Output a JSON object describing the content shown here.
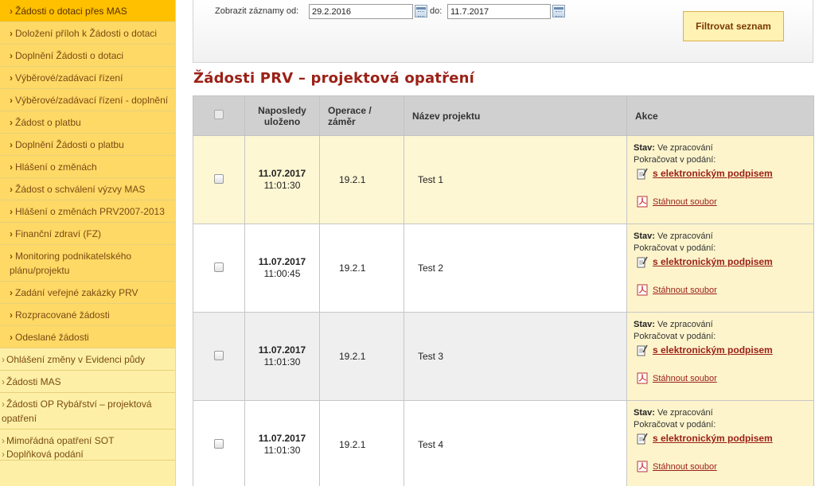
{
  "sidebar": {
    "items": [
      {
        "label": "Žádosti o dotaci přes MAS",
        "active": true
      },
      {
        "label": "Doložení příloh k Žádosti o dotaci"
      },
      {
        "label": "Doplnění Žádosti o dotaci"
      },
      {
        "label": "Výběrové/zadávací řízení"
      },
      {
        "label": "Výběrové/zadávací řízení - doplnění"
      },
      {
        "label": "Žádost o platbu"
      },
      {
        "label": "Doplnění Žádosti o platbu"
      },
      {
        "label": "Hlášení o změnách"
      },
      {
        "label": "Žádost o schválení výzvy MAS"
      },
      {
        "label": "Hlášení o změnách PRV2007-2013"
      },
      {
        "label": "Finanční zdraví (FZ)"
      },
      {
        "label": "Monitoring podnikatelského plánu/projektu"
      },
      {
        "label": "Zadání veřejné zakázky PRV"
      },
      {
        "label": "Rozpracované žádosti"
      },
      {
        "label": "Odeslané žádosti"
      }
    ],
    "top_items": [
      {
        "label": "Ohlášení změny v Evidenci půdy"
      },
      {
        "label": "Žádosti MAS"
      },
      {
        "label": "Žádosti OP Rybářství – projektová opatření"
      },
      {
        "label": "Mimořádná opatření SOT"
      },
      {
        "label": "Doplňková podání"
      }
    ]
  },
  "filter": {
    "from_label": "Zobrazit záznamy od:",
    "from_value": "29.2.2016",
    "to_label": "do:",
    "to_value": "11.7.2017",
    "button_label": "Filtrovat seznam"
  },
  "section_title": "Žádosti PRV – projektová opatření",
  "table": {
    "headers": {
      "last_saved": "Naposledy uloženo",
      "operation": "Operace / záměr",
      "name": "Název projektu",
      "actions": "Akce"
    },
    "rows": [
      {
        "date": "11.07.2017",
        "time": "11:01:30",
        "operation": "19.2.1",
        "name": "Test 1"
      },
      {
        "date": "11.07.2017",
        "time": "11:00:45",
        "operation": "19.2.1",
        "name": "Test 2"
      },
      {
        "date": "11.07.2017",
        "time": "11:01:30",
        "operation": "19.2.1",
        "name": "Test 3"
      },
      {
        "date": "11.07.2017",
        "time": "11:01:30",
        "operation": "19.2.1",
        "name": "Test 4"
      }
    ],
    "action_texts": {
      "status_label": "Stav:",
      "status_value": "Ve zpracování",
      "continue_text": "Pokračovat v podání:",
      "sign_link": "s elektronickým podpisem",
      "download_link": "Stáhnout soubor"
    }
  },
  "colors": {
    "sidebar_item": "#ffd966",
    "sidebar_active": "#ffc000",
    "sidebar_top": "#fdf0a6",
    "link": "#9b2117",
    "header_bg": "#d0d0d0"
  },
  "icons": {
    "calendar": "calendar-icon",
    "sign": "signature-icon",
    "pdf": "pdf-icon"
  }
}
